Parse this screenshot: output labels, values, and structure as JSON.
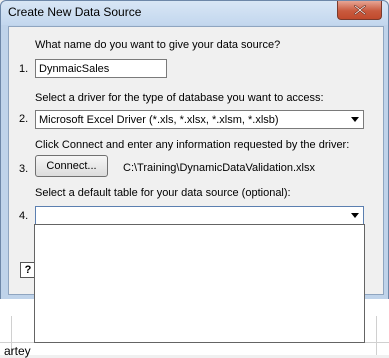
{
  "window": {
    "title": "Create New Data Source",
    "close_icon": "close-x-icon",
    "close_color": "#c95a3e"
  },
  "steps": [
    {
      "number": "1.",
      "prompt": "What name do you want to give your data source?",
      "value": "DynmaicSales"
    },
    {
      "number": "2.",
      "prompt": "Select a driver for the type of database you want to access:",
      "value": "Microsoft Excel Driver (*.xls, *.xlsx, *.xlsm, *.xlsb)"
    },
    {
      "number": "3.",
      "prompt": "Click Connect and enter any information requested by the driver:",
      "button": "Connect...",
      "path": "C:\\Training\\DynamicDataValidation.xlsx"
    },
    {
      "number": "4.",
      "prompt": "Select a default table for your data source (optional):",
      "value": ""
    }
  ],
  "dropdown": {
    "open": true,
    "options": []
  },
  "help": {
    "icon": "help-question-icon",
    "glyph": "?"
  },
  "background": {
    "partial_text": "artey"
  }
}
